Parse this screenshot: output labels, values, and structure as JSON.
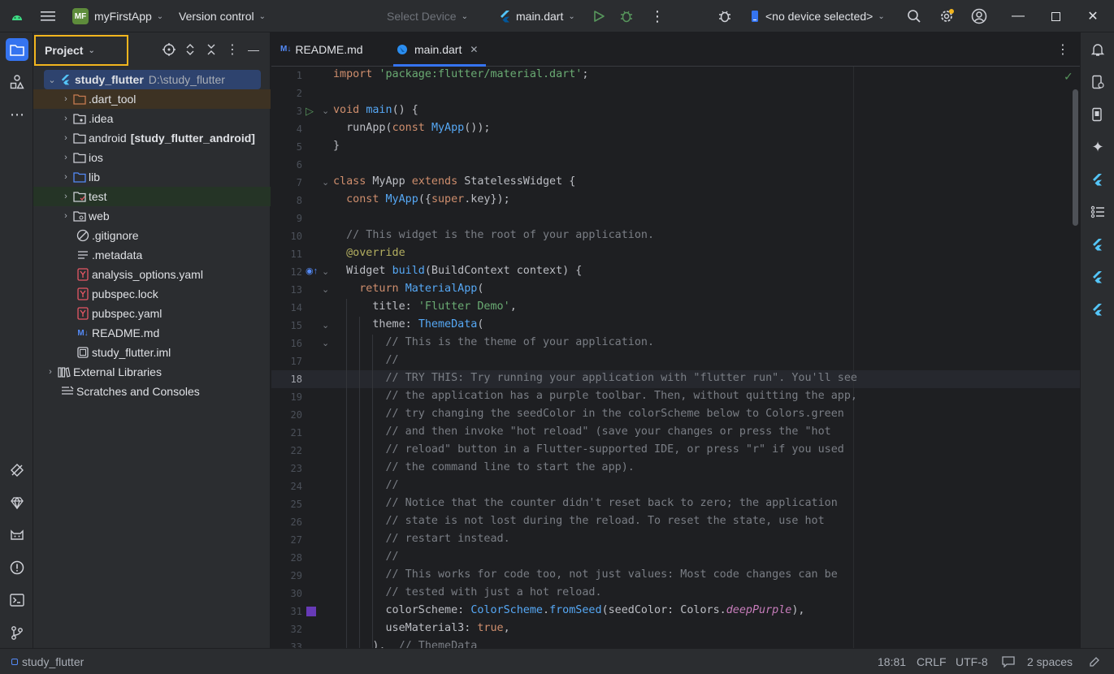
{
  "titlebar": {
    "project_badge": "MF",
    "project_name": "myFirstApp",
    "version_control": "Version control",
    "select_device": "Select Device",
    "run_config": "main.dart",
    "device_selector": "<no device selected>"
  },
  "project_panel": {
    "title": "Project",
    "tree": [
      {
        "name": "study_flutter",
        "secondary": "D:\\study_flutter",
        "icon": "flutter-icon"
      },
      {
        "name": ".dart_tool",
        "icon": "folder-icon"
      },
      {
        "name": ".idea",
        "icon": "folder-config-icon"
      },
      {
        "name": "android",
        "secondary": "[study_flutter_android]",
        "icon": "folder-icon"
      },
      {
        "name": "ios",
        "icon": "folder-icon"
      },
      {
        "name": "lib",
        "icon": "source-folder-icon"
      },
      {
        "name": "test",
        "icon": "test-folder-icon"
      },
      {
        "name": "web",
        "icon": "folder-web-icon"
      },
      {
        "name": ".gitignore",
        "icon": "ignore-file-icon"
      },
      {
        "name": ".metadata",
        "icon": "text-file-icon"
      },
      {
        "name": "analysis_options.yaml",
        "icon": "yaml-icon"
      },
      {
        "name": "pubspec.lock",
        "icon": "yaml-icon"
      },
      {
        "name": "pubspec.yaml",
        "icon": "yaml-icon"
      },
      {
        "name": "README.md",
        "icon": "markdown-icon"
      },
      {
        "name": "study_flutter.iml",
        "icon": "module-file-icon"
      },
      {
        "name": "External Libraries",
        "icon": "library-icon"
      },
      {
        "name": "Scratches and Consoles",
        "icon": "scratches-icon"
      }
    ]
  },
  "tabs": [
    {
      "label": "README.md",
      "icon": "markdown-icon"
    },
    {
      "label": "main.dart",
      "icon": "dart-icon"
    }
  ],
  "editor": {
    "current_line": 18,
    "line_numbers": [
      "1",
      "2",
      "3",
      "4",
      "5",
      "6",
      "7",
      "8",
      "9",
      "10",
      "11",
      "12",
      "13",
      "14",
      "15",
      "16",
      "17",
      "18",
      "19",
      "20",
      "21",
      "22",
      "23",
      "24",
      "25",
      "26",
      "27",
      "28",
      "29",
      "30",
      "31",
      "32",
      "33"
    ]
  },
  "status": {
    "breadcrumb": "study_flutter",
    "position": "18:81",
    "line_separator": "CRLF",
    "encoding": "UTF-8",
    "indent": "2 spaces"
  },
  "colors": {
    "accent": "#3574f0",
    "highlight_border": "#f2b51e",
    "swatch_deep_purple": "#673ab7"
  }
}
